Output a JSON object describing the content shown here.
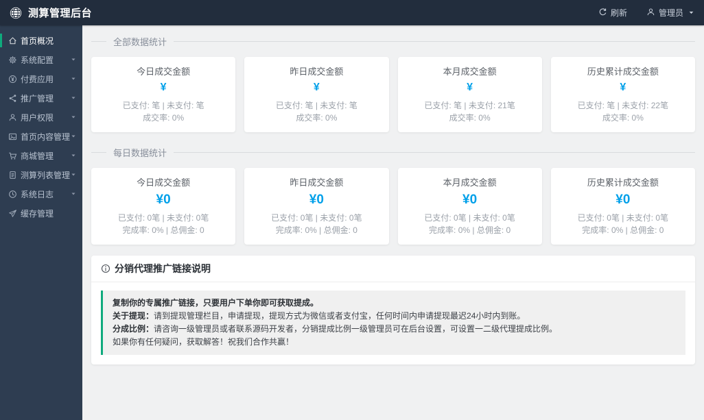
{
  "header": {
    "title": "测算管理后台",
    "refresh_label": "刷新",
    "user_label": "管理员"
  },
  "sidebar": {
    "items": [
      {
        "label": "首页概况",
        "icon": "home-icon",
        "active": true,
        "has_arrow": false
      },
      {
        "label": "系统配置",
        "icon": "gear-icon",
        "active": false,
        "has_arrow": true
      },
      {
        "label": "付费应用",
        "icon": "yen-circle-icon",
        "active": false,
        "has_arrow": true
      },
      {
        "label": "推广管理",
        "icon": "share-icon",
        "active": false,
        "has_arrow": true
      },
      {
        "label": "用户权限",
        "icon": "user-icon",
        "active": false,
        "has_arrow": true
      },
      {
        "label": "首页内容管理",
        "icon": "image-icon",
        "active": false,
        "has_arrow": true
      },
      {
        "label": "商城管理",
        "icon": "cart-icon",
        "active": false,
        "has_arrow": true
      },
      {
        "label": "测算列表管理",
        "icon": "document-icon",
        "active": false,
        "has_arrow": true
      },
      {
        "label": "系统日志",
        "icon": "clock-icon",
        "active": false,
        "has_arrow": true
      },
      {
        "label": "缓存管理",
        "icon": "send-icon",
        "active": false,
        "has_arrow": false
      }
    ]
  },
  "sections": [
    {
      "title": "全部数据统计",
      "style": "all",
      "cards": [
        {
          "title": "今日成交金额",
          "amount": "¥",
          "line1": "已支付: 笔 | 未支付: 笔",
          "line2": "成交率: 0%"
        },
        {
          "title": "昨日成交金额",
          "amount": "¥",
          "line1": "已支付: 笔 | 未支付: 笔",
          "line2": "成交率: 0%"
        },
        {
          "title": "本月成交金额",
          "amount": "¥",
          "line1": "已支付: 笔 | 未支付: 21笔",
          "line2": "成交率: 0%"
        },
        {
          "title": "历史累计成交金额",
          "amount": "¥",
          "line1": "已支付: 笔 | 未支付: 22笔",
          "line2": "成交率: 0%"
        }
      ]
    },
    {
      "title": "每日数据统计",
      "style": "daily",
      "cards": [
        {
          "title": "今日成交金额",
          "amount": "¥0",
          "line1": "已支付: 0笔 | 未支付: 0笔",
          "line2": "完成率: 0% | 总佣金: 0"
        },
        {
          "title": "昨日成交金额",
          "amount": "¥0",
          "line1": "已支付: 0笔 | 未支付: 0笔",
          "line2": "完成率: 0% | 总佣金: 0"
        },
        {
          "title": "本月成交金额",
          "amount": "¥0",
          "line1": "已支付: 0笔 | 未支付: 0笔",
          "line2": "完成率: 0% | 总佣金: 0"
        },
        {
          "title": "历史累计成交金额",
          "amount": "¥0",
          "line1": "已支付: 0笔 | 未支付: 0笔",
          "line2": "完成率: 0% | 总佣金: 0"
        }
      ]
    }
  ],
  "notice": {
    "title": "分销代理推广链接说明",
    "icon": "info-circle-icon",
    "lines": [
      {
        "bold": "复制你的专属推广链接，只要用户下单你即可获取提成。",
        "rest": ""
      },
      {
        "bold": "关于提现：",
        "rest": "请到提现管理栏目，申请提现，提现方式为微信或者支付宝，任何时间内申请提现最迟24小时内到账。"
      },
      {
        "bold": "分成比例：",
        "rest": "请咨询一级管理员或者联系源码开发者，分销提成比例一级管理员可在后台设置，可设置一二级代理提成比例。"
      },
      {
        "bold": "",
        "rest": "如果你有任何疑问，获取解答！祝我们合作共赢！"
      }
    ]
  },
  "colors": {
    "accent_blue": "#00a0e9",
    "accent_green": "#0faa7d",
    "header_bg": "#222d3d",
    "sidebar_bg": "#2e3d51",
    "content_bg": "#f0f1f2"
  }
}
